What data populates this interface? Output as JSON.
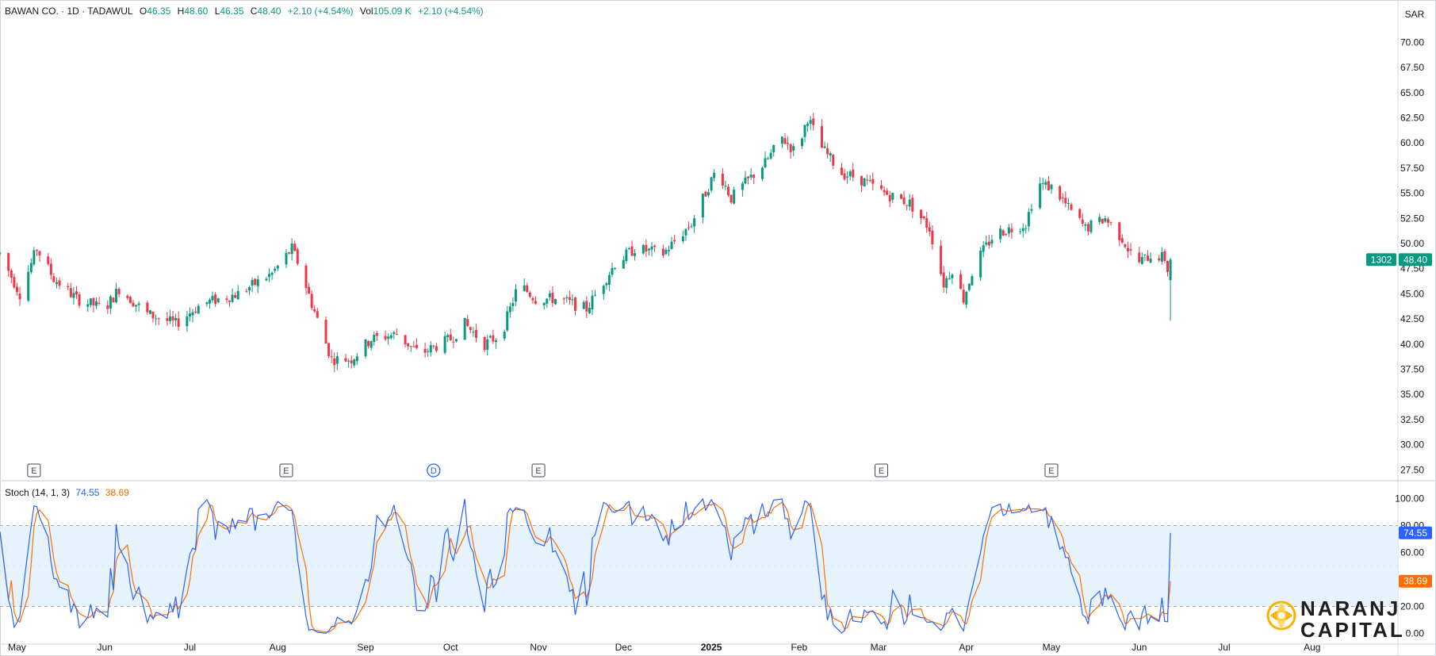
{
  "header": {
    "symbol": "BAWAN CO. · 1D · TADAWUL",
    "open_label": "O",
    "open": "46.35",
    "high_label": "H",
    "high": "48.60",
    "low_label": "L",
    "low": "46.35",
    "close_label": "C",
    "close": "48.40",
    "change": "+2.10 (+4.54%)",
    "vol_label": "Vol",
    "vol": "105.09 K",
    "vol_change": "+2.10 (+4.54%)"
  },
  "currency": "SAR",
  "price_badge": {
    "symbol_code": "1302",
    "last": "48.40"
  },
  "stoch": {
    "label": "Stoch (14, 1, 3)",
    "k_value": "74.55",
    "d_value": "38.69"
  },
  "events": [
    {
      "label": "E",
      "date": "2024-05-07"
    },
    {
      "label": "E",
      "date": "2024-08-04"
    },
    {
      "label": "D",
      "date": "2024-09-25"
    },
    {
      "label": "E",
      "date": "2024-11-01"
    },
    {
      "label": "E",
      "date": "2025-03-02"
    },
    {
      "label": "E",
      "date": "2025-05-01"
    }
  ],
  "logo": {
    "line1": "NARANJ",
    "line2": "CAPITAL"
  },
  "colors": {
    "up": "#089981",
    "down": "#f23645",
    "k_line": "#2962ff",
    "d_line": "#ff6d00",
    "band": "#e3f2fd"
  },
  "chart_data": [
    {
      "type": "candlestick",
      "x_axis": {
        "start": "2024-04-25",
        "end": "2025-08-31",
        "ticks": [
          "May",
          "Jun",
          "Jul",
          "Aug",
          "Sep",
          "Oct",
          "Nov",
          "Dec",
          "2025",
          "Feb",
          "Mar",
          "Apr",
          "May",
          "Jun",
          "Jul",
          "Aug"
        ]
      },
      "y_axis": {
        "ylim": [
          26.5,
          72.0
        ],
        "ticks": [
          "27.50",
          "30.00",
          "32.50",
          "35.00",
          "37.50",
          "40.00",
          "42.50",
          "45.00",
          "47.50",
          "50.00",
          "52.50",
          "55.00",
          "57.50",
          "60.00",
          "62.50",
          "65.00",
          "67.50",
          "70.00"
        ]
      },
      "anchors": [
        [
          "2024-04-25",
          49.0
        ],
        [
          "2024-05-02",
          45.0
        ],
        [
          "2024-05-08",
          49.5
        ],
        [
          "2024-05-14",
          46.5
        ],
        [
          "2024-05-22",
          44.5
        ],
        [
          "2024-06-01",
          43.5
        ],
        [
          "2024-06-06",
          45.5
        ],
        [
          "2024-06-16",
          43.0
        ],
        [
          "2024-06-26",
          42.0
        ],
        [
          "2024-07-05",
          44.0
        ],
        [
          "2024-07-18",
          45.0
        ],
        [
          "2024-07-30",
          47.0
        ],
        [
          "2024-08-06",
          49.5
        ],
        [
          "2024-08-09",
          47.5
        ],
        [
          "2024-08-13",
          44.0
        ],
        [
          "2024-08-20",
          38.5
        ],
        [
          "2024-08-27",
          38.5
        ],
        [
          "2024-09-03",
          40.5
        ],
        [
          "2024-09-12",
          41.0
        ],
        [
          "2024-09-20",
          39.0
        ],
        [
          "2024-10-01",
          40.5
        ],
        [
          "2024-10-06",
          42.0
        ],
        [
          "2024-10-13",
          40.0
        ],
        [
          "2024-10-19",
          41.0
        ],
        [
          "2024-10-25",
          46.0
        ],
        [
          "2024-10-31",
          44.5
        ],
        [
          "2024-11-08",
          44.5
        ],
        [
          "2024-11-18",
          43.5
        ],
        [
          "2024-11-28",
          48.0
        ],
        [
          "2024-12-05",
          49.5
        ],
        [
          "2024-12-15",
          49.0
        ],
        [
          "2024-12-25",
          52.0
        ],
        [
          "2025-01-03",
          57.5
        ],
        [
          "2025-01-08",
          54.5
        ],
        [
          "2025-01-13",
          56.0
        ],
        [
          "2025-01-20",
          58.0
        ],
        [
          "2025-01-26",
          60.5
        ],
        [
          "2025-01-31",
          59.0
        ],
        [
          "2025-02-04",
          62.5
        ],
        [
          "2025-02-09",
          59.5
        ],
        [
          "2025-02-16",
          57.0
        ],
        [
          "2025-02-22",
          56.5
        ],
        [
          "2025-03-03",
          55.0
        ],
        [
          "2025-03-12",
          54.0
        ],
        [
          "2025-03-19",
          51.5
        ],
        [
          "2025-03-24",
          46.0
        ],
        [
          "2025-03-27",
          47.5
        ],
        [
          "2025-03-31",
          44.5
        ],
        [
          "2025-04-04",
          48.0
        ],
        [
          "2025-04-11",
          51.0
        ],
        [
          "2025-04-17",
          51.5
        ],
        [
          "2025-04-22",
          52.0
        ],
        [
          "2025-04-26",
          56.0
        ],
        [
          "2025-05-02",
          55.5
        ],
        [
          "2025-05-07",
          53.5
        ],
        [
          "2025-05-13",
          51.5
        ],
        [
          "2025-05-20",
          52.5
        ],
        [
          "2025-05-26",
          50.5
        ],
        [
          "2025-05-31",
          48.0
        ],
        [
          "2025-06-06",
          49.0
        ],
        [
          "2025-06-10",
          48.5
        ],
        [
          "2025-06-12",
          46.35
        ],
        [
          "2025-06-13",
          48.4
        ]
      ],
      "last_candle": {
        "date": "2025-06-13",
        "open": 46.35,
        "high": 48.6,
        "low": 42.3,
        "close": 48.4
      }
    },
    {
      "type": "line",
      "title": "Stoch (14, 1, 3)",
      "y_axis": {
        "ylim": [
          -8,
          108
        ],
        "ticks": [
          "0.00",
          "20.00",
          "40.00",
          "60.00",
          "80.00",
          "100.00"
        ],
        "bands": [
          20,
          50,
          80
        ]
      },
      "series": [
        {
          "name": "%K",
          "last": 74.55
        },
        {
          "name": "%D",
          "last": 38.69
        }
      ]
    }
  ]
}
